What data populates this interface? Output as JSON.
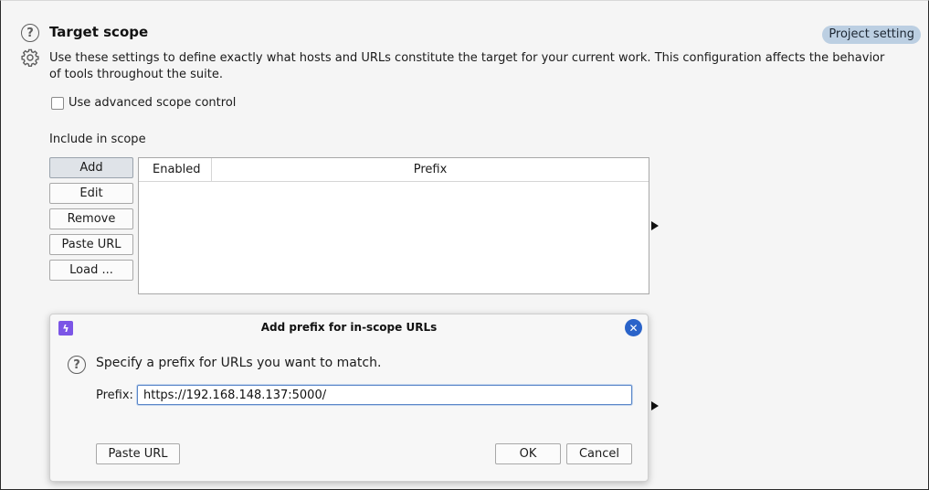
{
  "page": {
    "title": "Target scope",
    "badge": "Project setting",
    "description": "Use these settings to define exactly what hosts and URLs constitute the target for your current work. This configuration affects the behavior of tools throughout the suite.",
    "advanced_scope_label": "Use advanced scope control",
    "advanced_scope_checked": false,
    "include_label": "Include in scope"
  },
  "buttons": {
    "add": "Add",
    "edit": "Edit",
    "remove": "Remove",
    "paste_url": "Paste URL",
    "load": "Load ..."
  },
  "table": {
    "columns": [
      "Enabled",
      "Prefix"
    ],
    "rows": []
  },
  "icons": {
    "help": "help-icon",
    "settings": "gear-icon",
    "close": "close-icon",
    "app": "lightning-icon"
  },
  "dialog": {
    "title": "Add prefix for in-scope URLs",
    "message": "Specify a prefix for URLs you want to match.",
    "prefix_label": "Prefix:",
    "prefix_value": "https://192.168.148.137:5000/",
    "paste_url": "Paste URL",
    "ok": "OK",
    "cancel": "Cancel"
  },
  "colors": {
    "badge_bg": "#bccfe2",
    "close_button": "#2a63c9",
    "app_icon": "#7b55e6",
    "input_focus": "#5a86c8"
  }
}
